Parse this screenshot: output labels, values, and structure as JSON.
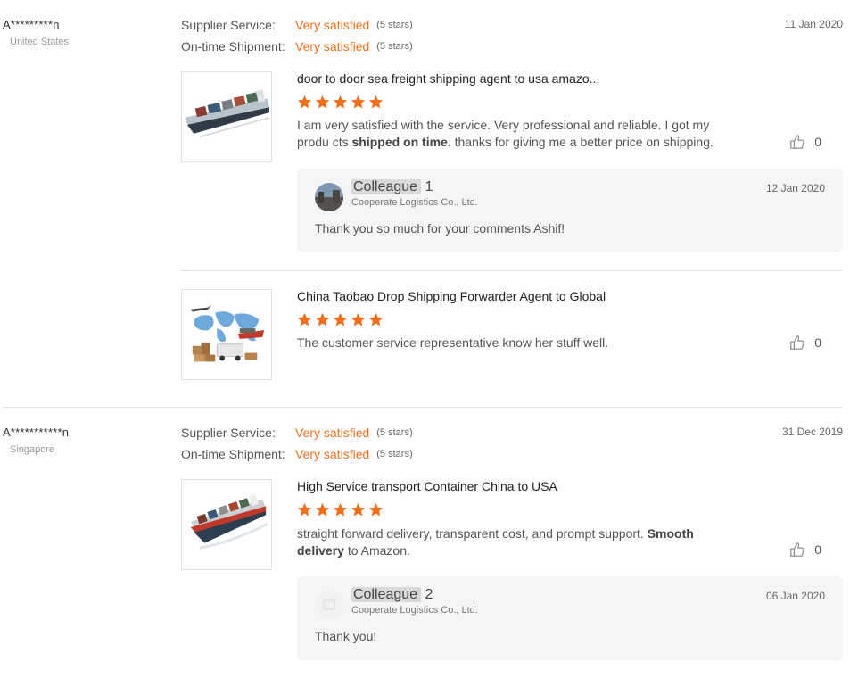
{
  "reviews": [
    {
      "user": "A*********n",
      "country": "United States",
      "date": "11 Jan 2020",
      "supplier_service_label": "Supplier Service:",
      "supplier_service_value": "Very satisfied",
      "supplier_service_stars": "(5 stars)",
      "shipment_label": "On-time Shipment:",
      "shipment_value": "Very satisfied",
      "shipment_stars": "(5 stars)",
      "products": [
        {
          "title": "door to door sea freight shipping agent to usa amazo...",
          "rating": 5,
          "comment_part1": "I am very satisfied with the service. Very professional and reliable. I got my produ cts ",
          "comment_bold": "shipped on time",
          "comment_part2": ". thanks for giving me a better price on shipping.",
          "likes": "0",
          "reply": {
            "name": "Colleague",
            "name_suffix": " 1",
            "company": "Cooperate Logistics Co., Ltd.",
            "date": "12 Jan 2020",
            "text": "Thank you so much for your comments Ashif!"
          }
        },
        {
          "title": "China Taobao Drop Shipping Forwarder Agent to Global",
          "rating": 5,
          "comment": "The customer service representative know her stuff well.",
          "likes": "0"
        }
      ]
    },
    {
      "user": "A***********n",
      "country": "Singapore",
      "date": "31 Dec 2019",
      "supplier_service_label": "Supplier Service:",
      "supplier_service_value": "Very satisfied",
      "supplier_service_stars": "(5 stars)",
      "shipment_label": "On-time Shipment:",
      "shipment_value": "Very satisfied",
      "shipment_stars": "(5 stars)",
      "products": [
        {
          "title": "High Service transport Container China to USA",
          "rating": 5,
          "comment_part1": "straight forward delivery, transparent cost, and prompt support. ",
          "comment_bold": "Smooth delivery",
          "comment_part2": " to Amazon.",
          "likes": "0",
          "reply": {
            "name": "Colleague",
            "name_suffix": " 2",
            "company": "Cooperate Logistics Co., Ltd.",
            "date": "06 Jan 2020",
            "text": "Thank you!"
          }
        }
      ]
    }
  ],
  "colors": {
    "accent": "#f26e1c",
    "star": "#f26e1c",
    "reply_bg": "#f4f5f7"
  },
  "icons": {
    "rating": "star-icon",
    "like": "thumbs-up-icon"
  }
}
